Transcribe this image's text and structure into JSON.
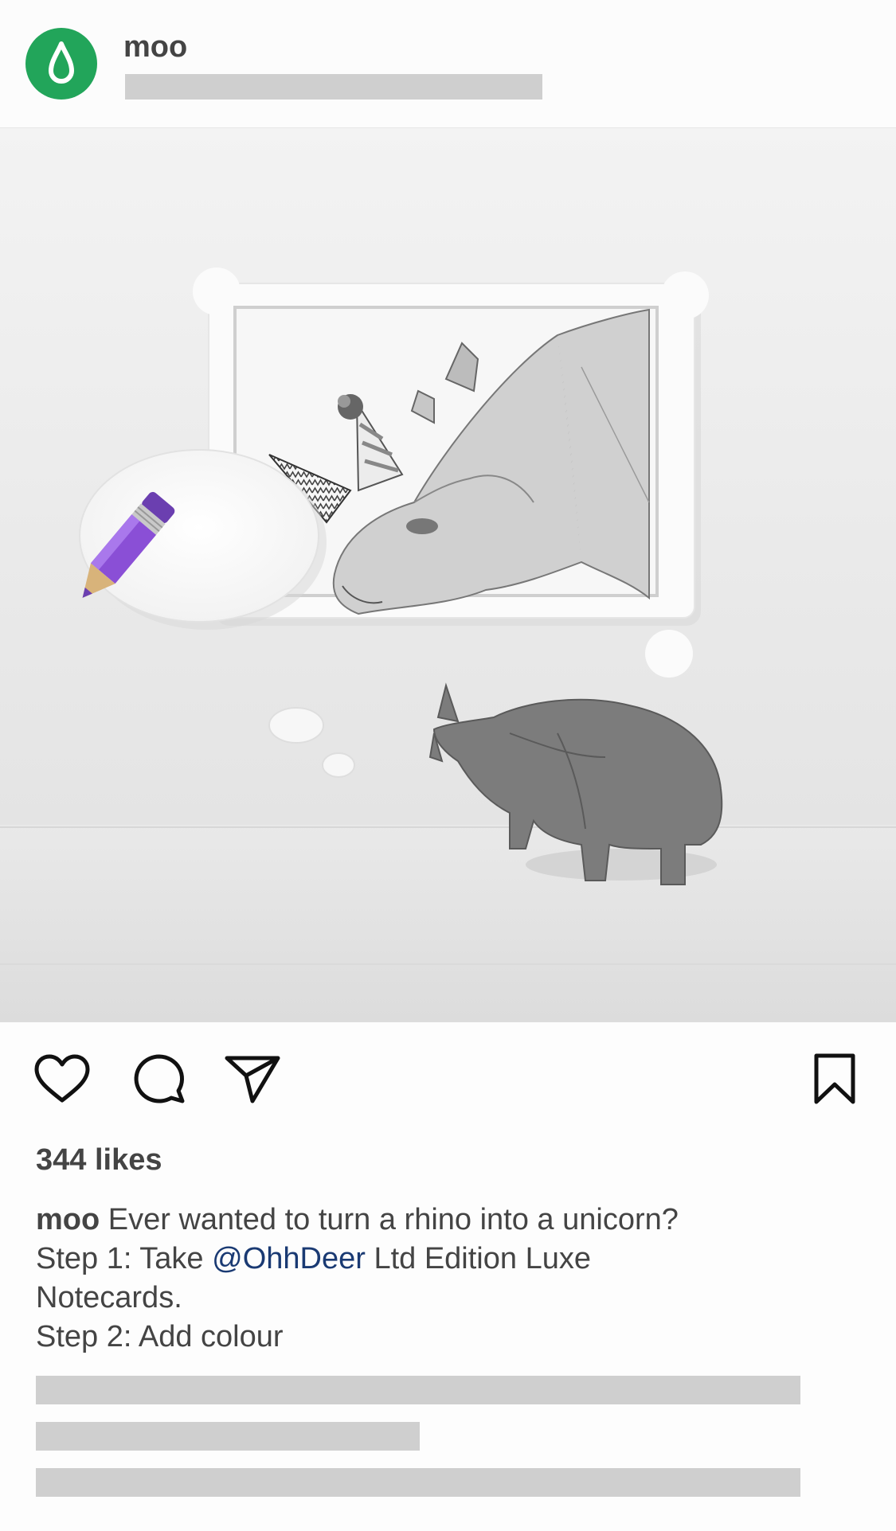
{
  "post": {
    "username": "moo",
    "likes": "344 likes",
    "caption": {
      "user": "moo",
      "line1": "Ever wanted to turn a rhino into a unicorn?",
      "line2_pre": "Step 1: Take ",
      "mention": "@OhhDeer",
      "line2_post": " Ltd Edition Luxe",
      "line3": "Notecards.",
      "line4": "Step 2: Add colour"
    }
  },
  "icons": {
    "avatar": "water-drop-icon",
    "like": "heart-icon",
    "comment": "comment-icon",
    "share": "paper-plane-icon",
    "save": "bookmark-icon"
  },
  "colors": {
    "brand": "#22a55a",
    "mention": "#1a3a73",
    "placeholder": "#cfcfcf",
    "pencil": "#8a4fd6"
  }
}
